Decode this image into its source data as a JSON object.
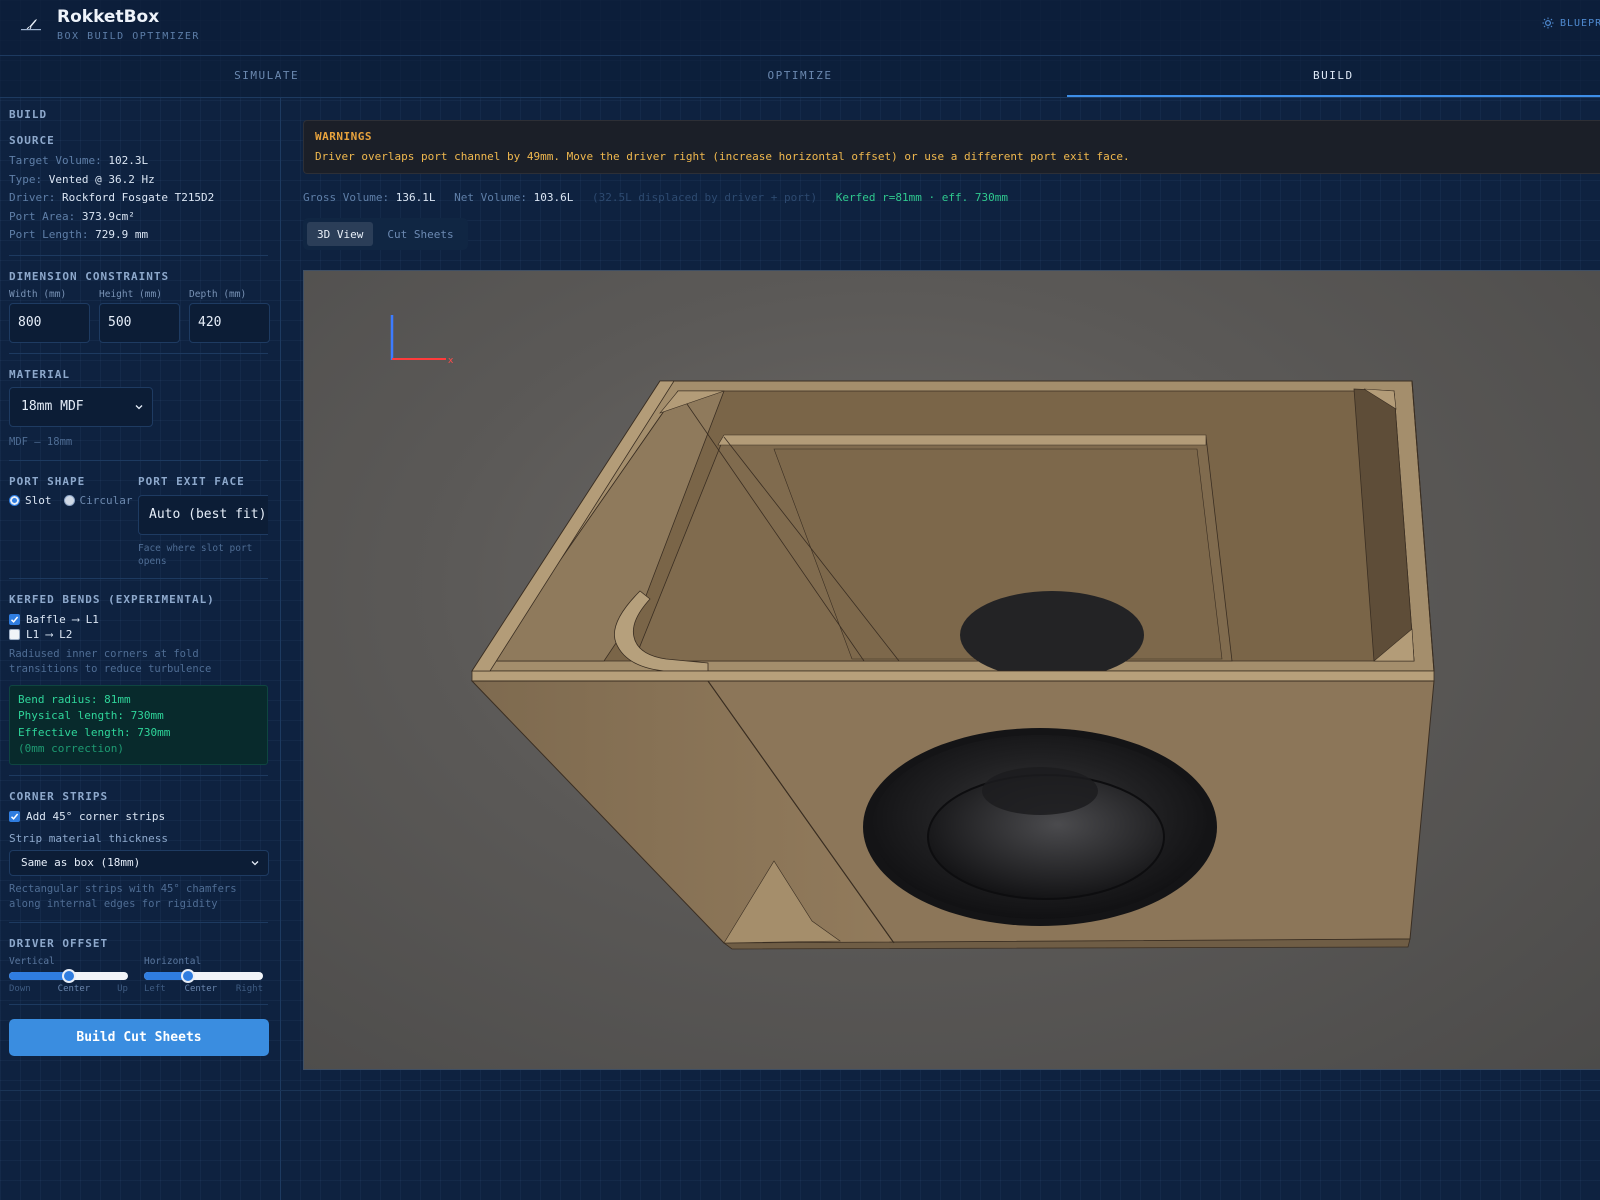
{
  "app": {
    "title": "RokketBox",
    "subtitle": "BOX BUILD OPTIMIZER",
    "mode_toggle": "BLUEPRI",
    "accent_color": "#3d8ee8"
  },
  "tabs": [
    {
      "label": "SIMULATE",
      "active": false
    },
    {
      "label": "OPTIMIZE",
      "active": false
    },
    {
      "label": "BUILD",
      "active": true
    }
  ],
  "sidebar": {
    "heading": "BUILD",
    "source": {
      "heading": "SOURCE",
      "rows": [
        {
          "key": "Target Volume:",
          "value": "102.3L"
        },
        {
          "key": "Type:",
          "value": "Vented @ 36.2 Hz"
        },
        {
          "key": "Driver:",
          "value": "Rockford Fosgate T215D2"
        },
        {
          "key": "Port Area:",
          "value": "373.9cm²"
        },
        {
          "key": "Port Length:",
          "value": "729.9 mm"
        }
      ]
    },
    "dimensions": {
      "heading": "DIMENSION CONSTRAINTS",
      "width_label": "Width (mm)",
      "width_value": "800",
      "height_label": "Height (mm)",
      "height_value": "500",
      "depth_label": "Depth (mm)",
      "depth_value": "420"
    },
    "material": {
      "heading": "MATERIAL",
      "selected": "18mm MDF",
      "note": "MDF — 18mm"
    },
    "port": {
      "shape_heading": "PORT SHAPE",
      "slot_label": "Slot",
      "circular_label": "Circular",
      "selected_shape": "Slot",
      "exit_heading": "PORT EXIT FACE",
      "exit_value": "Auto (best fit)",
      "exit_hint": "Face where slot port opens"
    },
    "kerf": {
      "heading": "KERFED BENDS (EXPERIMENTAL)",
      "option1": "Baffle ⟶ L1",
      "option1_checked": true,
      "option2": "L1 ⟶ L2",
      "option2_checked": false,
      "description": "Radiused inner corners at fold transitions to reduce turbulence",
      "bend_radius": "Bend radius: 81mm",
      "physical_length": "Physical length: 730mm",
      "effective_length": "Effective length: 730mm",
      "correction": "(0mm correction)"
    },
    "corner_strips": {
      "heading": "CORNER STRIPS",
      "add_label": "Add 45° corner strips",
      "add_checked": true,
      "thickness_label": "Strip material thickness",
      "thickness_value": "Same as box (18mm)",
      "description": "Rectangular strips with 45° chamfers along internal edges for rigidity"
    },
    "driver_offset": {
      "heading": "DRIVER OFFSET",
      "vertical": {
        "label": "Vertical",
        "min": "Down",
        "mid": "Center",
        "max": "Up",
        "value": 0.5
      },
      "horizontal": {
        "label": "Horizontal",
        "min": "Left",
        "mid": "Center",
        "max": "Right",
        "value": 0.37
      }
    },
    "build_button": "Build Cut Sheets"
  },
  "main": {
    "warning_title": "WARNINGS",
    "warning_message": "Driver overlaps port channel by 49mm. Move the driver right (increase horizontal offset) or use a different port exit face.",
    "stats": {
      "gross_label": "Gross Volume:",
      "gross_value": "136.1L",
      "net_label": "Net Volume:",
      "net_value": "103.6L",
      "displaced_note": "(32.5L displaced by driver + port)",
      "kerf_note": "Kerfed r=81mm · eff. 730mm"
    },
    "view_tabs": [
      {
        "label": "3D View",
        "active": true
      },
      {
        "label": "Cut Sheets",
        "active": false
      }
    ],
    "viewport": {
      "axis_x_label": "x",
      "wood_color": "#8c7659",
      "driver_color": "#2a2a2c"
    }
  }
}
